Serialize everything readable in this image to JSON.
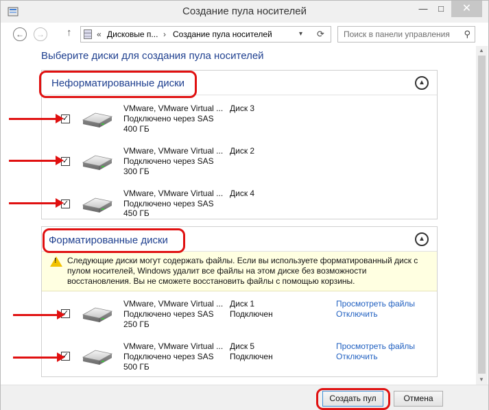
{
  "window": {
    "title": "Создание пула носителей",
    "minimize_glyph": "—",
    "maximize_glyph": "□",
    "close_glyph": "✕"
  },
  "address_bar": {
    "chevron": "«",
    "crumbs": [
      "Дисковые п...",
      "Создание пула носителей"
    ],
    "separator": "›",
    "dropdown_glyph": "▾",
    "refresh_glyph": "⟳"
  },
  "search": {
    "placeholder": "Поиск в панели управления"
  },
  "nav": {
    "back_glyph": "←",
    "forward_glyph": "→",
    "up_glyph": "↑"
  },
  "heading": "Выберите диски для создания пула носителей",
  "unformatted": {
    "title": "Неформатированные диски",
    "collapse_glyph": "▲",
    "disks": [
      {
        "checked": "✓",
        "name": "VMware, VMware Virtual ...",
        "connection": "Подключено через SAS",
        "size": "400 ГБ",
        "number": "Диск 3"
      },
      {
        "checked": "✓",
        "name": "VMware, VMware Virtual ...",
        "connection": "Подключено через SAS",
        "size": "300 ГБ",
        "number": "Диск 2"
      },
      {
        "checked": "✓",
        "name": "VMware, VMware Virtual ...",
        "connection": "Подключено через SAS",
        "size": "450 ГБ",
        "number": "Диск 4"
      }
    ]
  },
  "formatted": {
    "title": "Форматированные диски",
    "collapse_glyph": "▲",
    "warning": "Следующие диски могут содержать файлы. Если вы используете форматированный диск с пулом носителей, Windows удалит все файлы на этом диске без возможности восстановления. Вы не сможете восстановить файлы с помощью корзины.",
    "warning_mark": "!",
    "disks": [
      {
        "checked": "✓",
        "name": "VMware, VMware Virtual ...",
        "connection": "Подключено через SAS",
        "size": "250 ГБ",
        "number": "Диск 1",
        "status": "Подключен",
        "view_files": "Просмотреть файлы",
        "disconnect": "Отключить"
      },
      {
        "checked": "✓",
        "name": "VMware, VMware Virtual ...",
        "connection": "Подключено через SAS",
        "size": "500 ГБ",
        "number": "Диск 5",
        "status": "Подключен",
        "view_files": "Просмотреть файлы",
        "disconnect": "Отключить"
      }
    ]
  },
  "scrollbar": {
    "up_glyph": "▲",
    "down_glyph": "▼"
  },
  "footer": {
    "create_label": "Создать пул",
    "cancel_label": "Отмена"
  },
  "colors": {
    "accent_heading": "#1e3f8f",
    "link": "#1f5fc0",
    "annotation_red": "#e01010",
    "warning_bg": "#ffffe1"
  }
}
